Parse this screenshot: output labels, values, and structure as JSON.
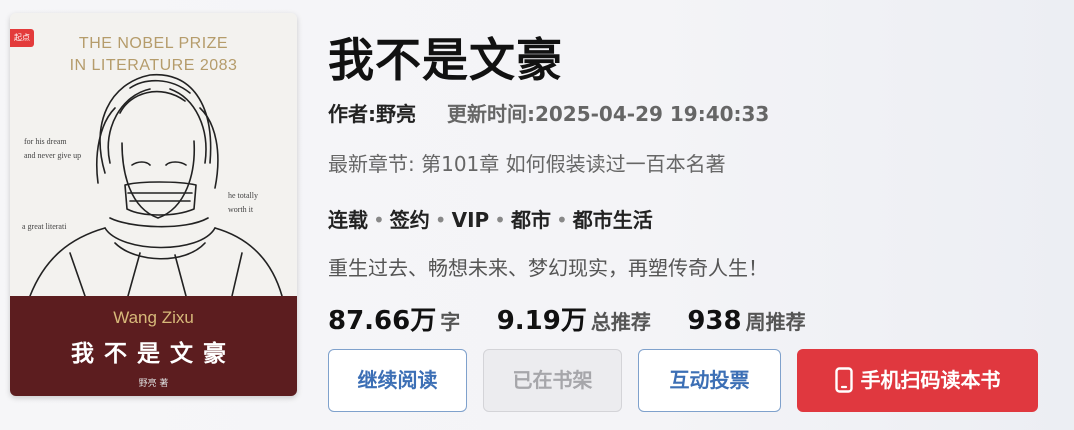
{
  "cover": {
    "badge": "起点",
    "prize_line1": "THE NOBEL PRIZE",
    "prize_line2": "IN LITERATURE 2083",
    "side_left_1": "for his dream",
    "side_left_2": "and never give up",
    "side_left_3": "a great literati",
    "side_right_1": "he totally",
    "side_right_2": "worth it",
    "author_en": "Wang Zixu",
    "title_cn": "我不是文豪",
    "author_cn": "野亮 著"
  },
  "book": {
    "title": "我不是文豪",
    "author": "作者:野亮",
    "updated": "更新时间:2025-04-29 19:40:33",
    "latest_chapter": "最新章节: 第101章 如何假装读过一百本名著",
    "tags": [
      "连载",
      "签约",
      "VIP",
      "都市",
      "都市生活"
    ],
    "intro": "重生过去、畅想未来、梦幻现实，再塑传奇人生！"
  },
  "stats": {
    "words_num": "87.66",
    "words_unit": "万",
    "words_label": "字",
    "total_rec_num": "9.19",
    "total_rec_unit": "万",
    "total_rec_label": "总推荐",
    "week_rec_num": "938",
    "week_rec_label": "周推荐"
  },
  "buttons": {
    "continue_read": "继续阅读",
    "in_shelf": "已在书架",
    "vote": "互动投票",
    "scan_read": "手机扫码读本书"
  },
  "colors": {
    "accent_blue": "#3c6fb5",
    "scan_red": "#e0383f",
    "cover_bottom": "#5c1d1f"
  }
}
